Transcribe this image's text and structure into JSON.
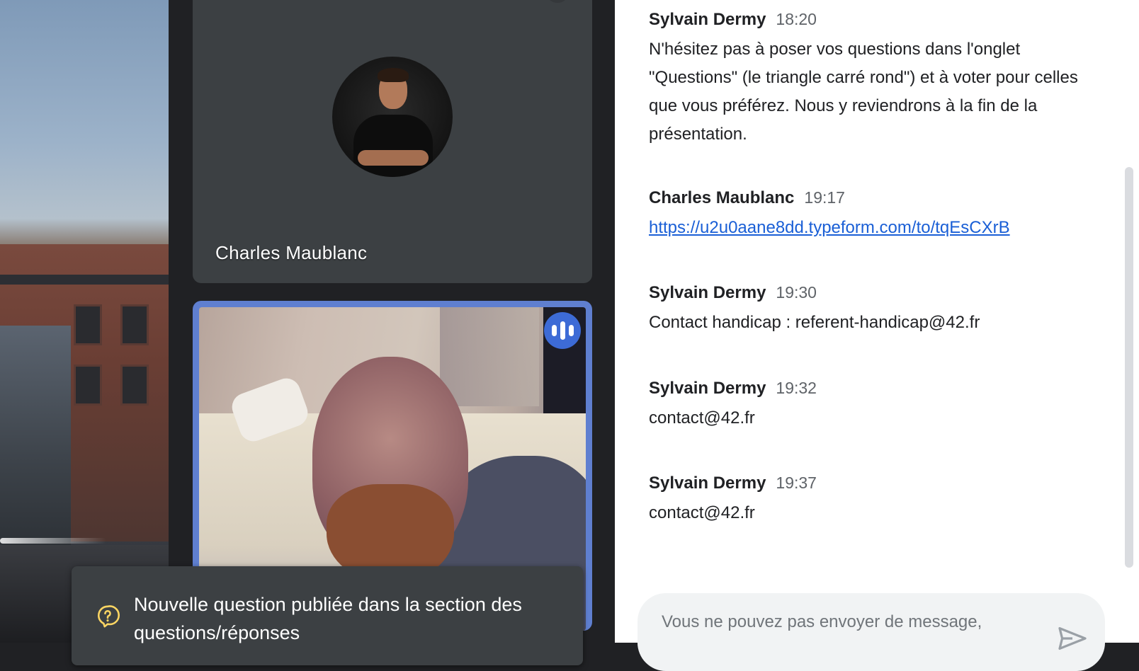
{
  "participants": [
    {
      "name": "Charles Maublanc"
    }
  ],
  "toast": {
    "text": "Nouvelle question publiée dans la section des questions/réponses",
    "icon": "question-icon",
    "icon_color": "#fdd663"
  },
  "chat": {
    "messages": [
      {
        "sender": "Sylvain Dermy",
        "time": "18:20",
        "text": "N'hésitez pas à poser vos questions dans l'onglet \"Questions\" (le triangle carré rond\") et à voter pour celles que vous préférez. Nous y reviendrons à la fin de la présentation."
      },
      {
        "sender": "Charles Maublanc",
        "time": "19:17",
        "link": "https://u2u0aane8dd.typeform.com/to/tqEsCXrB"
      },
      {
        "sender": "Sylvain Dermy",
        "time": "19:30",
        "text": "Contact handicap : referent-handicap@42.fr"
      },
      {
        "sender": "Sylvain Dermy",
        "time": "19:32",
        "text": "contact@42.fr"
      },
      {
        "sender": "Sylvain Dermy",
        "time": "19:37",
        "text": "contact@42.fr"
      }
    ],
    "composer_placeholder": "Vous ne pouvez pas envoyer de message,",
    "send_icon": "send-icon"
  },
  "colors": {
    "active_speaker_border": "#5f7fd0",
    "audio_indicator": "#3d6bd6",
    "link": "#1a5fd6"
  }
}
